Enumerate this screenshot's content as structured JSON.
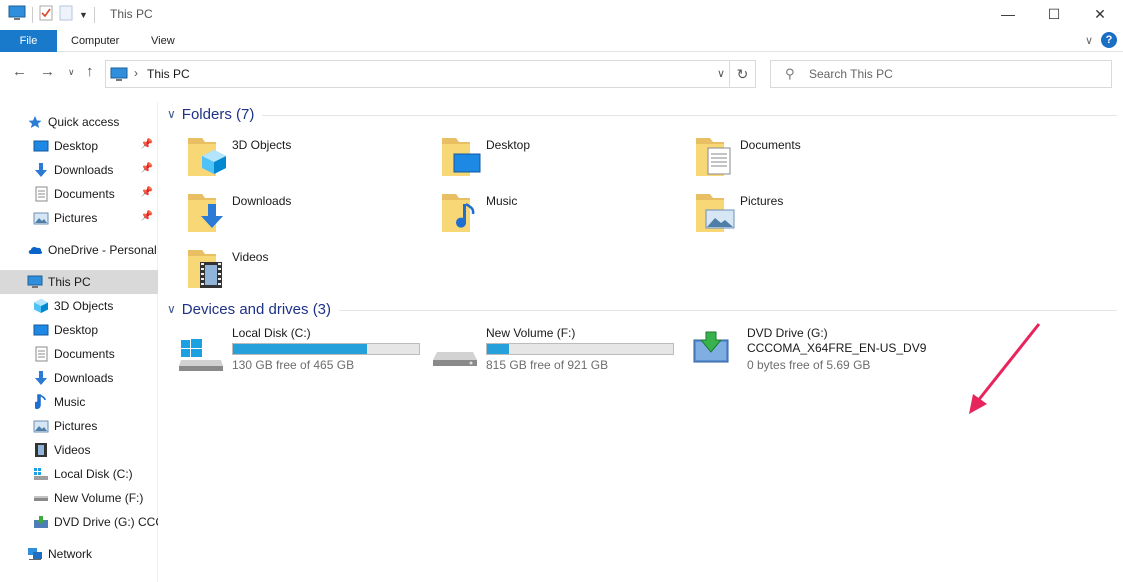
{
  "window": {
    "title": "This PC",
    "controls": [
      "minimize-icon",
      "maximize-icon",
      "close-icon"
    ]
  },
  "ribbon": {
    "tabs": [
      {
        "label": "File"
      },
      {
        "label": "Computer"
      },
      {
        "label": "View"
      }
    ]
  },
  "address": {
    "crumb": "This PC",
    "search_placeholder": "Search This PC"
  },
  "sidebar": {
    "items": [
      {
        "label": "Quick access"
      },
      {
        "label": "Desktop"
      },
      {
        "label": "Downloads"
      },
      {
        "label": "Documents"
      },
      {
        "label": "Pictures"
      },
      {
        "label": "OneDrive - Personal"
      },
      {
        "label": "This PC"
      },
      {
        "label": "3D Objects"
      },
      {
        "label": "Desktop"
      },
      {
        "label": "Documents"
      },
      {
        "label": "Downloads"
      },
      {
        "label": "Music"
      },
      {
        "label": "Pictures"
      },
      {
        "label": "Videos"
      },
      {
        "label": "Local Disk (C:)"
      },
      {
        "label": "New Volume (F:)"
      },
      {
        "label": "DVD Drive (G:) CCC"
      },
      {
        "label": "Network"
      }
    ]
  },
  "folders": {
    "header": "Folders (7)",
    "items": [
      {
        "label": "3D Objects"
      },
      {
        "label": "Desktop"
      },
      {
        "label": "Documents"
      },
      {
        "label": "Downloads"
      },
      {
        "label": "Music"
      },
      {
        "label": "Pictures"
      },
      {
        "label": "Videos"
      }
    ]
  },
  "devices": {
    "header": "Devices and drives (3)",
    "drives": [
      {
        "name": "Local Disk (C:)",
        "free": "130 GB free of 465 GB",
        "used_fraction": 0.72
      },
      {
        "name": "New Volume (F:)",
        "free": "815 GB free of 921 GB",
        "used_fraction": 0.12
      },
      {
        "name": "DVD Drive (G:)",
        "volume": "CCCOMA_X64FRE_EN-US_DV9",
        "free": "0 bytes free of 5.69 GB"
      }
    ]
  },
  "colors": {
    "accent": "#1979ca",
    "drive_bar": "#26a0da",
    "annotation_arrow": "#e8245c",
    "group_header": "#1e3287"
  }
}
